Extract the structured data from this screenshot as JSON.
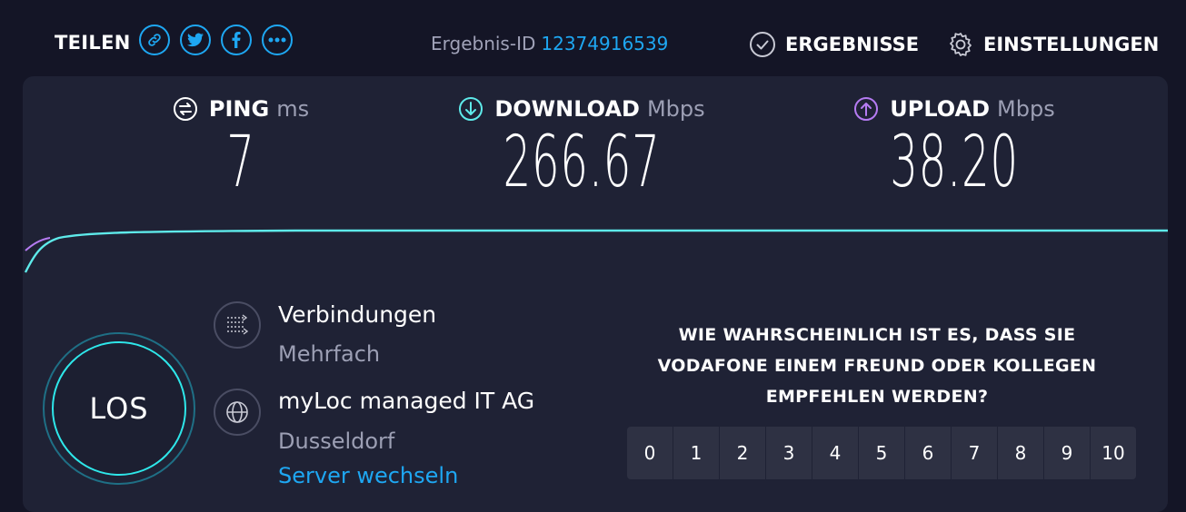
{
  "share": {
    "label": "TEILEN",
    "icons": [
      "link-icon",
      "twitter-icon",
      "facebook-icon",
      "more-icon"
    ]
  },
  "result": {
    "label": "Ergebnis-ID",
    "id": "12374916539"
  },
  "nav": {
    "results": "ERGEBNISSE",
    "settings": "EINSTELLUNGEN"
  },
  "metrics": {
    "ping": {
      "name": "PING",
      "unit": "ms",
      "value": "7"
    },
    "download": {
      "name": "DOWNLOAD",
      "unit": "Mbps",
      "value": "266.67"
    },
    "upload": {
      "name": "UPLOAD",
      "unit": "Mbps",
      "value": "38.20"
    }
  },
  "go_label": "LOS",
  "connections": {
    "title": "Verbindungen",
    "value": "Mehrfach"
  },
  "server": {
    "name": "myLoc managed IT AG",
    "location": "Dusseldorf",
    "change": "Server wechseln"
  },
  "survey": {
    "question": "WIE WAHRSCHEINLICH IST ES, DASS SIE VODAFONE EINEM FREUND ODER KOLLEGEN EMPFEHLEN WERDEN?",
    "options": [
      "0",
      "1",
      "2",
      "3",
      "4",
      "5",
      "6",
      "7",
      "8",
      "9",
      "10"
    ]
  },
  "colors": {
    "accent": "#1ea7f2",
    "download": "#5eeaea",
    "upload": "#b57bf2",
    "background": "#141526",
    "card": "#1f2235"
  }
}
